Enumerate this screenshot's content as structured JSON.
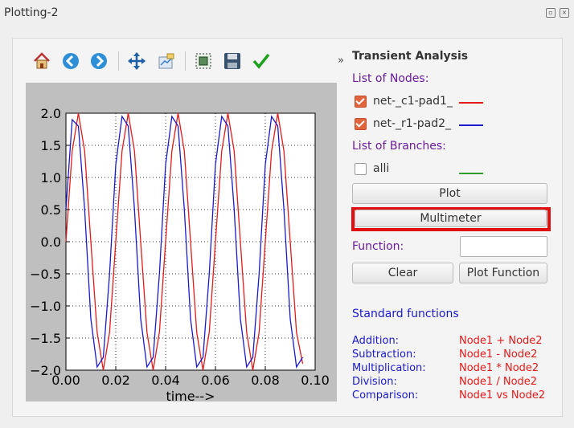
{
  "window": {
    "title": "Plotting-2"
  },
  "toolbar": {
    "icons": [
      "home-icon",
      "back-icon",
      "forward-icon",
      "pan-icon",
      "configure-icon",
      "zoom-to-rect-icon",
      "save-icon",
      "check-icon"
    ],
    "overflow_glyph": "»"
  },
  "side": {
    "heading": "Transient Analysis",
    "nodes_label": "List of Nodes:",
    "nodes": [
      {
        "name": "net-_c1-pad1_",
        "checked": true,
        "color": "#e31a1a"
      },
      {
        "name": "net-_r1-pad2_",
        "checked": true,
        "color": "#1a1acc"
      }
    ],
    "branches_label": "List of Branches:",
    "branches": [
      {
        "name": "alli",
        "checked": false,
        "color": "#2e9e2e"
      }
    ],
    "plot_button": "Plot",
    "multimeter_button": "Multimeter",
    "function_label": "Function:",
    "function_value": "",
    "clear_button": "Clear",
    "plot_function_button": "Plot Function",
    "standard_functions_label": "Standard functions",
    "functions": [
      {
        "name": "Addition:",
        "expr": "Node1 + Node2"
      },
      {
        "name": "Subtraction:",
        "expr": "Node1 - Node2"
      },
      {
        "name": "Multiplication:",
        "expr": "Node1 * Node2"
      },
      {
        "name": "Division:",
        "expr": "Node1 / Node2"
      },
      {
        "name": "Comparison:",
        "expr": "Node1 vs Node2"
      }
    ]
  },
  "chart_data": {
    "type": "line",
    "xlabel": "time-->",
    "ylabel": "",
    "xlim": [
      0.0,
      0.1
    ],
    "ylim": [
      -2.0,
      2.0
    ],
    "xticks": [
      "0.00",
      "0.02",
      "0.04",
      "0.06",
      "0.08",
      "0.10"
    ],
    "yticks": [
      "2.0",
      "1.5",
      "1.0",
      "0.5",
      "0.0",
      "−0.5",
      "−1.0",
      "−1.5",
      "−2.0"
    ],
    "grid": true,
    "series": [
      {
        "color": "#e31a1a",
        "x": [
          0,
          0.0025,
          0.005,
          0.0075,
          0.01,
          0.0125,
          0.015,
          0.0175,
          0.02,
          0.0225,
          0.025,
          0.0275,
          0.03,
          0.0325,
          0.035,
          0.0375,
          0.04,
          0.0425,
          0.045,
          0.0475,
          0.05,
          0.0525,
          0.055,
          0.0575,
          0.06,
          0.0625,
          0.065,
          0.0675,
          0.07,
          0.0725,
          0.075,
          0.0775,
          0.08,
          0.0825,
          0.085,
          0.0875,
          0.09,
          0.0925,
          0.095
        ],
        "y": [
          0,
          1.41,
          2.0,
          1.41,
          0,
          -1.41,
          -2.0,
          -1.41,
          0,
          1.41,
          2.0,
          1.41,
          0,
          -1.41,
          -2.0,
          -1.41,
          0,
          1.41,
          2.0,
          1.41,
          0,
          -1.41,
          -2.0,
          -1.41,
          0,
          1.41,
          2.0,
          1.41,
          0,
          -1.41,
          -2.0,
          -1.41,
          0,
          1.41,
          2.0,
          1.41,
          0,
          -1.41,
          -1.9
        ]
      },
      {
        "color": "#1a1acc",
        "x": [
          0,
          0.0025,
          0.005,
          0.0075,
          0.01,
          0.0125,
          0.015,
          0.0175,
          0.02,
          0.0225,
          0.025,
          0.0275,
          0.03,
          0.0325,
          0.035,
          0.0375,
          0.04,
          0.0425,
          0.045,
          0.0475,
          0.05,
          0.0525,
          0.055,
          0.0575,
          0.06,
          0.0625,
          0.065,
          0.0675,
          0.07,
          0.0725,
          0.075,
          0.0775,
          0.08,
          0.0825,
          0.085,
          0.0875,
          0.09,
          0.0925,
          0.095
        ],
        "y": [
          0.5,
          1.9,
          1.8,
          0.5,
          -1.2,
          -1.95,
          -1.8,
          -0.5,
          1.2,
          1.95,
          1.8,
          0.5,
          -1.2,
          -1.95,
          -1.8,
          -0.5,
          1.2,
          1.95,
          1.8,
          0.5,
          -1.2,
          -1.95,
          -1.8,
          -0.5,
          1.2,
          1.95,
          1.8,
          0.5,
          -1.2,
          -1.95,
          -1.8,
          -0.5,
          1.2,
          1.95,
          1.8,
          0.5,
          -1.2,
          -1.95,
          -1.8
        ]
      }
    ]
  }
}
